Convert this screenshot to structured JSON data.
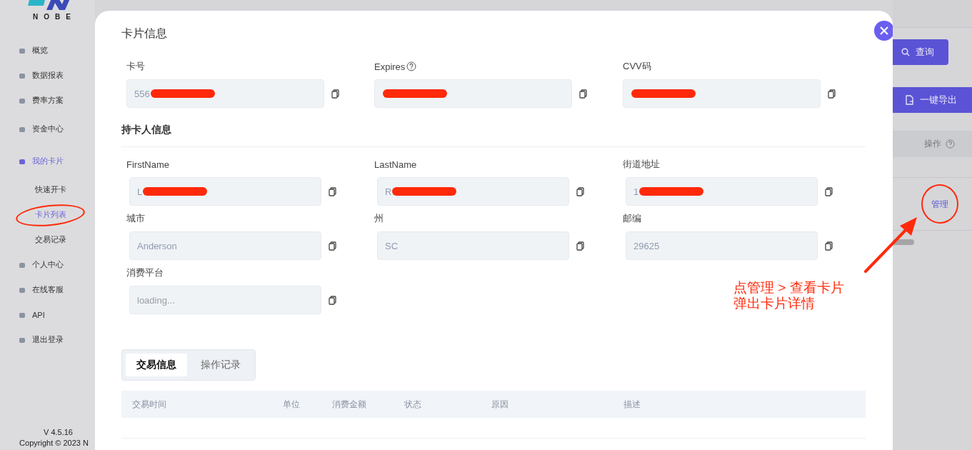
{
  "sidebar": {
    "logo": "NOBE",
    "items": [
      {
        "label": "概览",
        "selected": false
      },
      {
        "label": "数据报表",
        "selected": false
      },
      {
        "label": "费率方案",
        "selected": false
      },
      {
        "label": "资金中心",
        "selected": false
      },
      {
        "label": "我的卡片",
        "selected": true,
        "children": [
          {
            "label": "快速开卡",
            "selected": false,
            "circled": false
          },
          {
            "label": "卡片列表",
            "selected": true,
            "circled": true
          },
          {
            "label": "交易记录",
            "selected": false,
            "circled": false
          }
        ]
      },
      {
        "label": "个人中心",
        "selected": false
      },
      {
        "label": "在线客服",
        "selected": false
      },
      {
        "label": "API",
        "selected": false
      },
      {
        "label": "退出登录",
        "selected": false
      }
    ],
    "version": "V 4.5.16",
    "copyright": "Copyright © 2023 N"
  },
  "dialog": {
    "title": "卡片信息",
    "card_fields": [
      {
        "label": "卡号",
        "value": "556",
        "help": false,
        "redacted": true
      },
      {
        "label": "Expires",
        "help": true,
        "redacted": true
      },
      {
        "label": "CVV码",
        "help": false,
        "redacted": true
      }
    ],
    "holder_title": "持卡人信息",
    "holder_fields": [
      {
        "label": "FirstName",
        "value": "L",
        "redacted": true
      },
      {
        "label": "LastName",
        "value": "R",
        "redacted": true
      },
      {
        "label": "街道地址",
        "value": "1",
        "redacted": true
      },
      {
        "label": "城市",
        "value": "Anderson",
        "redacted": false
      },
      {
        "label": "州",
        "value": "SC",
        "redacted": false
      },
      {
        "label": "邮编",
        "value": "29625",
        "redacted": false
      },
      {
        "label": "消费平台",
        "placeholder": "loading...",
        "redacted": false
      }
    ],
    "tabs": [
      {
        "label": "交易信息",
        "selected": true
      },
      {
        "label": "操作记录",
        "selected": false
      }
    ],
    "table": {
      "columns": [
        "交易时间",
        "单位",
        "消费金额",
        "状态",
        "原因",
        "描述"
      ]
    }
  },
  "background": {
    "search_button": "查询",
    "export_button": "一键导出",
    "table_header": "操作",
    "row_action": {
      "label": "管理",
      "circled": true
    }
  },
  "annotation": {
    "lines": [
      "点管理 > 查看卡片",
      "弹出卡片详情"
    ]
  }
}
